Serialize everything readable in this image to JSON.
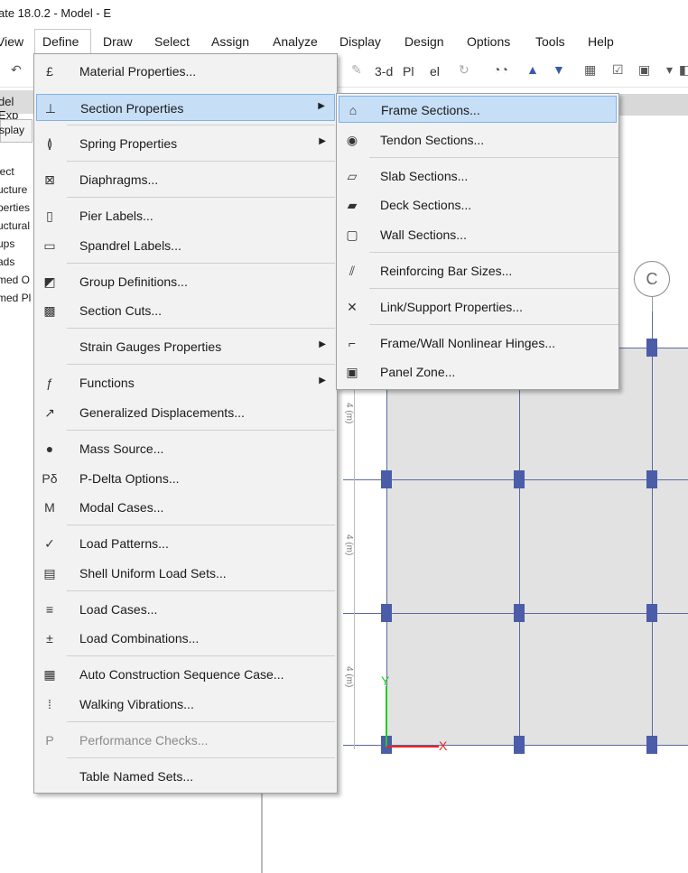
{
  "window": {
    "title": "ate 18.0.2 - Model - E"
  },
  "menubar": [
    {
      "label": "View"
    },
    {
      "label": "Define"
    },
    {
      "label": "Draw"
    },
    {
      "label": "Select"
    },
    {
      "label": "Assign"
    },
    {
      "label": "Analyze"
    },
    {
      "label": "Display"
    },
    {
      "label": "Design"
    },
    {
      "label": "Options"
    },
    {
      "label": "Tools"
    },
    {
      "label": "Help"
    }
  ],
  "toolbar": {
    "view_3d": "3-d",
    "view_plan": "Pl",
    "view_elev": "el"
  },
  "left_panel": {
    "tab": "del Exp",
    "button": "splay",
    "tree": [
      "ject",
      "ucture",
      "perties",
      "uctural",
      "ups",
      "ads",
      "med O",
      "med Pl"
    ]
  },
  "define_menu": {
    "items": [
      {
        "label": "Material Properties...",
        "icon": "material-icon",
        "glyph": "£"
      },
      {
        "label": "Section Properties",
        "icon": "section-icon",
        "glyph": "⊥",
        "submenu": true,
        "highlighted": true
      },
      {
        "label": "Spring Properties",
        "icon": "spring-icon",
        "glyph": "≬",
        "submenu": true
      },
      {
        "label": "Diaphragms...",
        "icon": "diaphragm-icon",
        "glyph": "⊠"
      },
      {
        "label": "Pier Labels...",
        "icon": "pier-icon",
        "glyph": "▯"
      },
      {
        "label": "Spandrel Labels...",
        "icon": "spandrel-icon",
        "glyph": "▭"
      },
      {
        "label": "Group Definitions...",
        "icon": "group-icon",
        "glyph": "◩"
      },
      {
        "label": "Section Cuts...",
        "icon": "section-cut-icon",
        "glyph": "▩"
      },
      {
        "label": "Strain Gauges Properties",
        "icon": "",
        "glyph": "",
        "submenu": true
      },
      {
        "label": "Functions",
        "icon": "functions-icon",
        "glyph": "ƒ",
        "submenu": true
      },
      {
        "label": "Generalized Displacements...",
        "icon": "displacement-icon",
        "glyph": "↗"
      },
      {
        "label": "Mass Source...",
        "icon": "mass-icon",
        "glyph": "●"
      },
      {
        "label": "P-Delta Options...",
        "icon": "pdelta-icon",
        "glyph": "Pδ"
      },
      {
        "label": "Modal Cases...",
        "icon": "modal-icon",
        "glyph": "M"
      },
      {
        "label": "Load Patterns...",
        "icon": "load-pattern-icon",
        "glyph": "✓"
      },
      {
        "label": "Shell Uniform Load Sets...",
        "icon": "shell-load-icon",
        "glyph": "▤"
      },
      {
        "label": "Load Cases...",
        "icon": "load-case-icon",
        "glyph": "≡"
      },
      {
        "label": "Load Combinations...",
        "icon": "load-combo-icon",
        "glyph": "±"
      },
      {
        "label": "Auto Construction Sequence Case...",
        "icon": "construction-icon",
        "glyph": "▦"
      },
      {
        "label": "Walking Vibrations...",
        "icon": "walking-icon",
        "glyph": "⁞"
      },
      {
        "label": "Performance Checks...",
        "icon": "performance-icon",
        "glyph": "P",
        "disabled": true
      },
      {
        "label": "Table Named Sets...",
        "icon": "",
        "glyph": ""
      }
    ]
  },
  "section_submenu": {
    "items": [
      {
        "label": "Frame Sections...",
        "icon": "frame-section-icon",
        "glyph": "⌂",
        "highlighted": true
      },
      {
        "label": "Tendon Sections...",
        "icon": "tendon-icon",
        "glyph": "◉"
      },
      {
        "label": "Slab Sections...",
        "icon": "slab-icon",
        "glyph": "▱"
      },
      {
        "label": "Deck Sections...",
        "icon": "deck-icon",
        "glyph": "▰"
      },
      {
        "label": "Wall Sections...",
        "icon": "wall-icon",
        "glyph": "▢"
      },
      {
        "label": "Reinforcing Bar Sizes...",
        "icon": "rebar-icon",
        "glyph": "⫽"
      },
      {
        "label": "Link/Support Properties...",
        "icon": "link-icon",
        "glyph": "✕"
      },
      {
        "label": "Frame/Wall Nonlinear Hinges...",
        "icon": "hinge-icon",
        "glyph": "⌐"
      },
      {
        "label": "Panel Zone...",
        "icon": "panel-zone-icon",
        "glyph": "▣"
      }
    ]
  },
  "model_view": {
    "grid_bubble": "C",
    "dimension": "4 (m)",
    "axis_x": "X",
    "axis_y": "Y"
  }
}
